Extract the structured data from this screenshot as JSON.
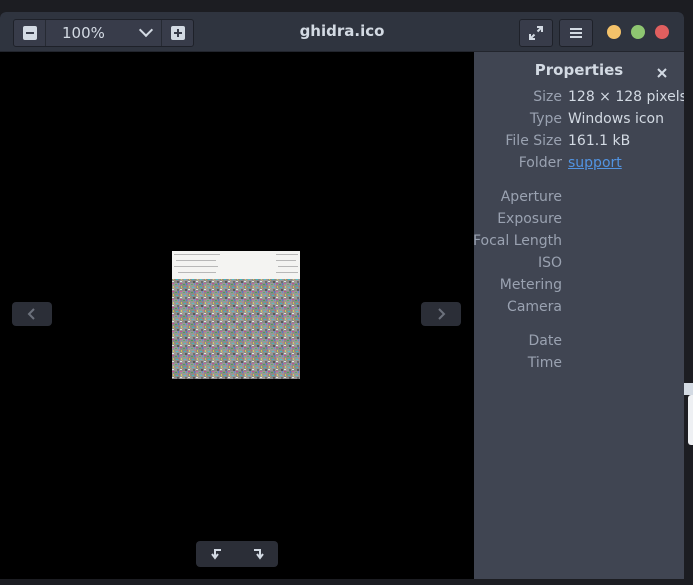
{
  "window": {
    "title": "ghidra.ico"
  },
  "toolbar": {
    "zoom_value": "100%",
    "zoom_out_icon": "zoom-out-icon",
    "zoom_in_icon": "zoom-in-icon",
    "fullscreen_icon": "fullscreen-icon",
    "menu_icon": "hamburger-menu-icon",
    "window_controls": {
      "minimize_color": "#f4c26a",
      "maximize_color": "#8ec671",
      "close_color": "#e05f5f"
    }
  },
  "viewer": {
    "prev_icon": "chevron-left-icon",
    "next_icon": "chevron-right-icon",
    "rotate_left_icon": "rotate-left-icon",
    "rotate_right_icon": "rotate-right-icon"
  },
  "properties": {
    "title": "Properties",
    "close_icon": "close-icon",
    "file": [
      {
        "label": "Size",
        "value": "128 × 128 pixels"
      },
      {
        "label": "Type",
        "value": "Windows icon"
      },
      {
        "label": "File Size",
        "value": "161.1 kB"
      },
      {
        "label": "Folder",
        "value": "support"
      }
    ],
    "exif": [
      {
        "label": "Aperture"
      },
      {
        "label": "Exposure"
      },
      {
        "label": "Focal Length"
      },
      {
        "label": "ISO"
      },
      {
        "label": "Metering"
      },
      {
        "label": "Camera"
      }
    ],
    "datetime": [
      {
        "label": "Date"
      },
      {
        "label": "Time"
      }
    ]
  },
  "colors": {
    "titlebar": "#2f343f",
    "panel": "#404552",
    "text": "#d3dae3",
    "muted_label": "#9aa2b1",
    "link": "#5294e2"
  }
}
